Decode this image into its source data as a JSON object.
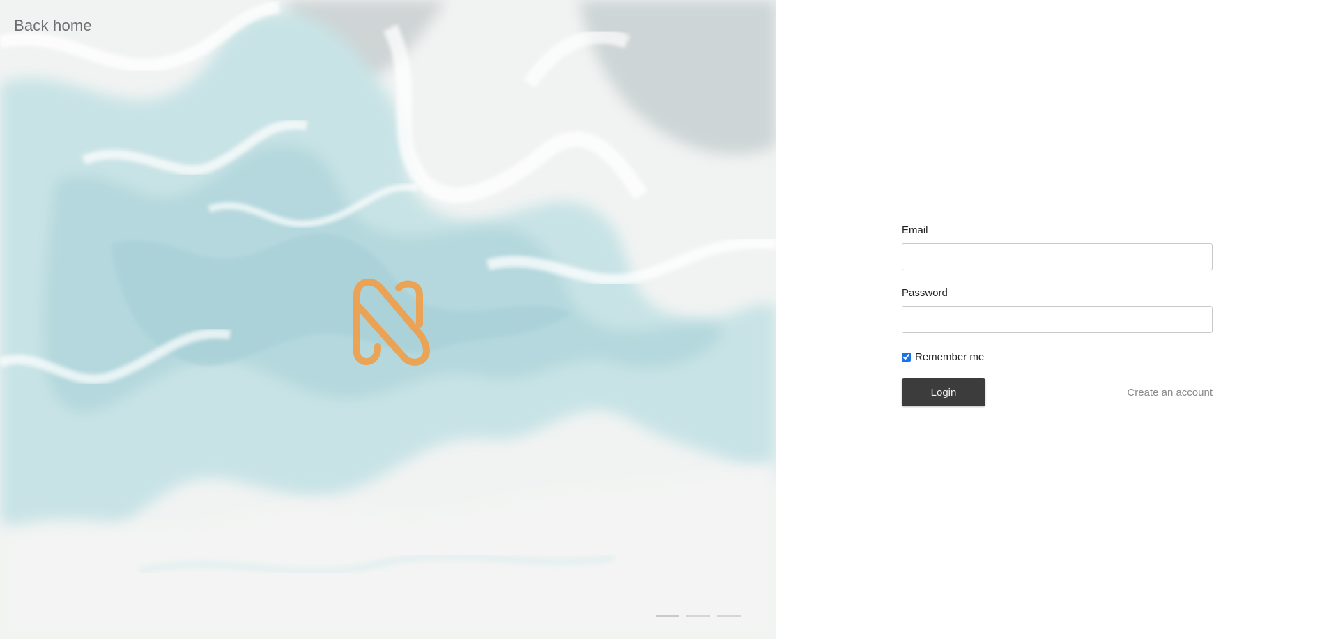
{
  "nav": {
    "back_home_label": "Back home"
  },
  "hero": {
    "logo_icon": "n-monogram-logo-icon",
    "logo_color": "#f0a04b",
    "slides": {
      "count": 3,
      "active_index": 0
    }
  },
  "login_form": {
    "email_label": "Email",
    "email_value": "",
    "password_label": "Password",
    "password_value": "",
    "remember_label": "Remember me",
    "remember_checked": true,
    "login_button_label": "Login",
    "create_account_label": "Create an account"
  },
  "colors": {
    "button_bg": "#3c3c3c",
    "link": "#8a8a8a",
    "checkbox_accent": "#1a73e8"
  }
}
